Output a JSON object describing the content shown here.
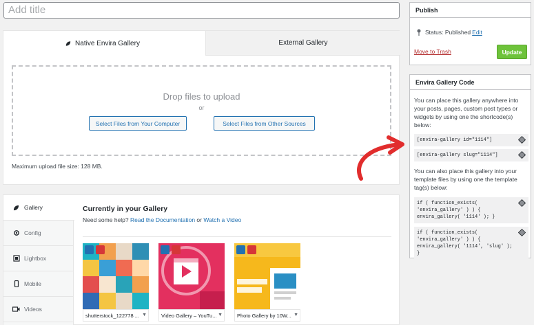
{
  "title": {
    "placeholder": "Add title"
  },
  "upload": {
    "tabs": [
      "Native Envira Gallery",
      "External Gallery"
    ],
    "drop_text": "Drop files to upload",
    "or_text": "or",
    "btn_computer": "Select Files from Your Computer",
    "btn_other": "Select Files from Other Sources",
    "max_size": "Maximum upload file size: 128 MB."
  },
  "gallery": {
    "side_tabs": [
      "Gallery",
      "Config",
      "Lightbox",
      "Mobile",
      "Videos"
    ],
    "title": "Currently in your Gallery",
    "help_prefix": "Need some help?",
    "help_docs": "Read the Documentation",
    "help_or": "or",
    "help_video": "Watch a Video",
    "items": [
      {
        "caption": "shutterstock_122778 ..."
      },
      {
        "caption": "Video Gallery – YouTu..."
      },
      {
        "caption": "Photo Gallery by 10W..."
      }
    ]
  },
  "publish": {
    "title": "Publish",
    "status_label": "Status: Published",
    "edit_link": "Edit",
    "trash": "Move to Trash",
    "update": "Update"
  },
  "code": {
    "title": "Envira Gallery Code",
    "desc1": "You can place this gallery anywhere into your posts, pages, custom post types or widgets by using one the shortcode(s) below:",
    "shortcode_id": "[envira-gallery id=\"1114\"]",
    "shortcode_slug": "[envira-gallery slug=\"1114\"]",
    "desc2": "You can also place this gallery into your template files by using one the template tag(s) below:",
    "tag_id": "if ( function_exists( 'envira_gallery' ) ) { envira_gallery( '1114' ); }",
    "tag_slug": "if ( function_exists( 'envira_gallery' ) ) { envira_gallery( '1114', 'slug' ); }"
  }
}
